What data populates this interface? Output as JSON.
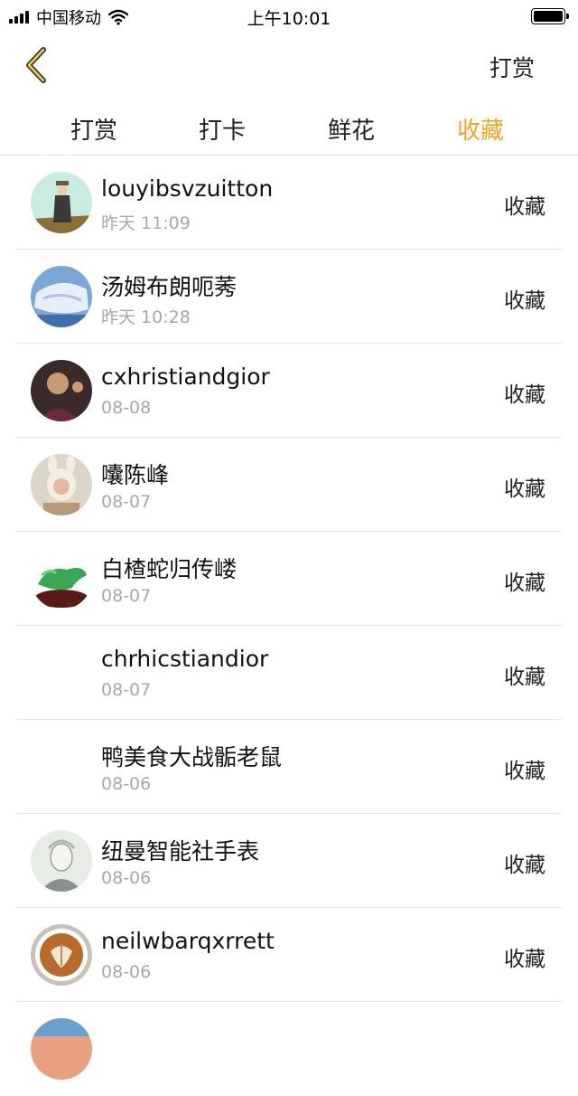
{
  "status_bar": {
    "carrier": "中国移动",
    "time": "上午10:01"
  },
  "navbar": {
    "back_icon": "chevron-left-icon",
    "action_label": "打赏",
    "accent_color": "#f0a323"
  },
  "tabs": [
    {
      "label": "打赏",
      "active": false
    },
    {
      "label": "打卡",
      "active": false
    },
    {
      "label": "鲜花",
      "active": false
    },
    {
      "label": "收藏",
      "active": true
    }
  ],
  "list": [
    {
      "name": "louyibsvzuitton",
      "time": "昨天 11:09",
      "action": "收藏",
      "avatar": "illustration"
    },
    {
      "name": "汤姆布朗呃莠",
      "time": "昨天 10:28",
      "action": "收藏",
      "avatar": "photo"
    },
    {
      "name": "cxhristiandgior",
      "time": "08-08",
      "action": "收藏",
      "avatar": "photo"
    },
    {
      "name": "囔陈峰",
      "time": "08-07",
      "action": "收藏",
      "avatar": "photo"
    },
    {
      "name": "白楂蛇归传嵝",
      "time": "08-07",
      "action": "收藏",
      "avatar": "photo"
    },
    {
      "name": "chrhicstiandior",
      "time": "08-07",
      "action": "收藏",
      "avatar": "none"
    },
    {
      "name": "鸭美食大战骺老鼠",
      "time": "08-06",
      "action": "收藏",
      "avatar": "none"
    },
    {
      "name": "纽曼智能社手表",
      "time": "08-06",
      "action": "收藏",
      "avatar": "illustration"
    },
    {
      "name": "neilwbarqxrrett",
      "time": "08-06",
      "action": "收藏",
      "avatar": "photo"
    }
  ]
}
